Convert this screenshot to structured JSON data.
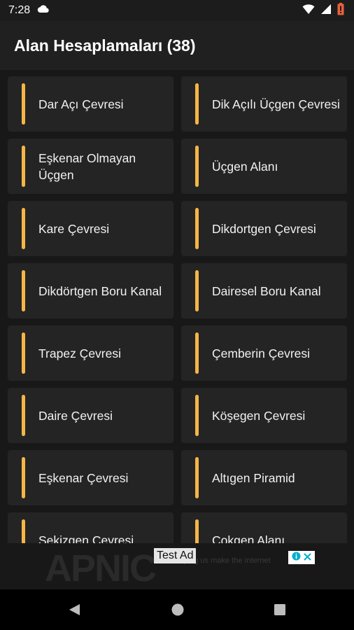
{
  "status_bar": {
    "time": "7:28",
    "icons": [
      "cloud-icon",
      "wifi-icon",
      "signal-icon",
      "battery-alert-icon"
    ]
  },
  "app_bar": {
    "title": "Alan Hesaplamaları (38)"
  },
  "accent_color": "#f5b547",
  "items": [
    {
      "label": "Dar Açı Çevresi"
    },
    {
      "label": "Dik Açılı Üçgen Çevresi"
    },
    {
      "label": "Eşkenar Olmayan Üçgen"
    },
    {
      "label": "Üçgen Alanı"
    },
    {
      "label": "Kare Çevresi"
    },
    {
      "label": "Dikdortgen Çevresi"
    },
    {
      "label": "Dikdörtgen Boru Kanal"
    },
    {
      "label": "Dairesel Boru Kanal"
    },
    {
      "label": "Trapez Çevresi"
    },
    {
      "label": "Çemberin Çevresi"
    },
    {
      "label": "Daire Çevresi"
    },
    {
      "label": "Köşegen Çevresi"
    },
    {
      "label": "Eşkenar Çevresi"
    },
    {
      "label": "Altıgen Piramid"
    },
    {
      "label": "Sekizgen Çevresi"
    },
    {
      "label": "Çokgen Alanı"
    }
  ],
  "ad": {
    "badge": "Test Ad",
    "logo_text": "APNIC",
    "tagline": "for helping us make the Internet",
    "adchoices_icon": "info-icon",
    "close_icon": "close-icon"
  },
  "nav_bar": {
    "back": "back-icon",
    "home": "home-icon",
    "recents": "recents-icon"
  }
}
